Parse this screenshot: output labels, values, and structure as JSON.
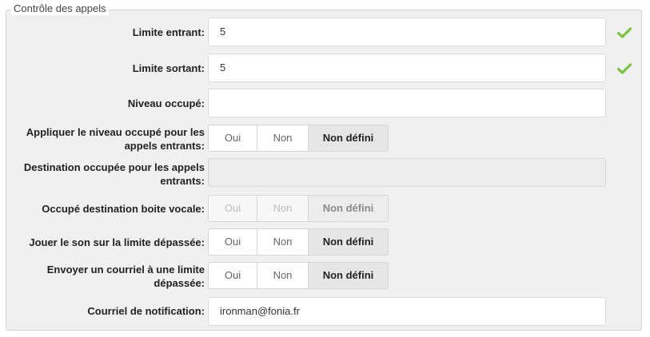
{
  "legend": "Contrôle des appels",
  "colors": {
    "check": "#7ac142",
    "selected": "#e6e6e6",
    "panel": "#f0f0f0"
  },
  "fields": {
    "incoming_limit": {
      "label": "Limite entrant:",
      "value": "5",
      "status_icon": "check-icon"
    },
    "outgoing_limit": {
      "label": "Limite sortant:",
      "value": "5",
      "status_icon": "check-icon"
    },
    "busy_level": {
      "label": "Niveau occupé:",
      "value": ""
    },
    "apply_busy_incoming": {
      "label_line1": "Appliquer le niveau occupé pour les",
      "label_line2": "appels entrants:",
      "options": [
        "Oui",
        "Non",
        "Non défini"
      ],
      "selected": "Non défini"
    },
    "busy_destination": {
      "label_line1": "Destination occupée pour les appels",
      "label_line2": "entrants:",
      "value": "",
      "disabled": true
    },
    "busy_voicemail": {
      "label": "Occupé destination boite vocale:",
      "options": [
        "Oui",
        "Non",
        "Non défini"
      ],
      "selected": "Non défini",
      "disabled": true
    },
    "play_sound_limit": {
      "label": "Jouer le son sur la limite dépassée:",
      "options": [
        "Oui",
        "Non",
        "Non défini"
      ],
      "selected": "Non défini"
    },
    "email_on_limit": {
      "label_line1": "Envoyer un courriel à une limite",
      "label_line2": "dépassée:",
      "options": [
        "Oui",
        "Non",
        "Non défini"
      ],
      "selected": "Non défini"
    },
    "notification_email": {
      "label": "Courriel de notification:",
      "value": "ironman@fonia.fr"
    }
  }
}
